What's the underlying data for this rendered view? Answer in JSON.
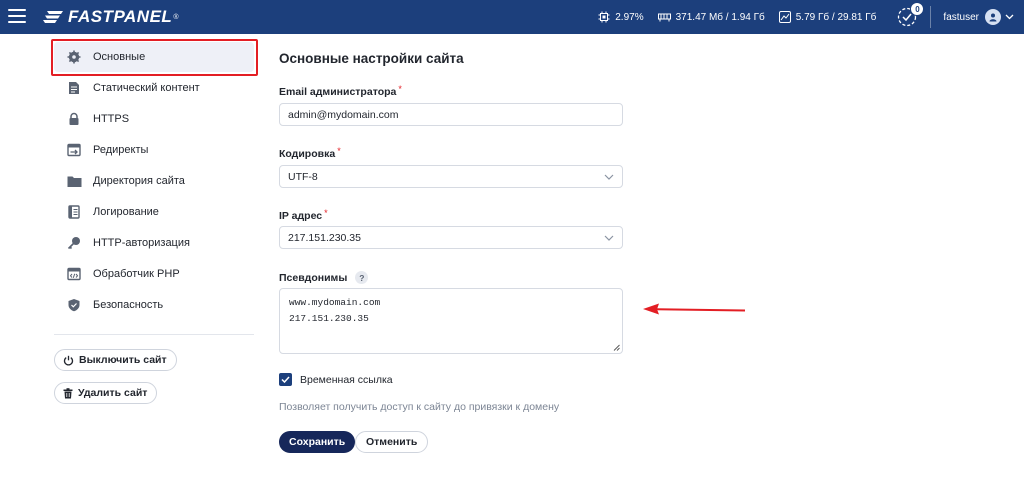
{
  "header": {
    "brand": "FASTPANEL",
    "brand_mark": "®",
    "cpu": "2.97%",
    "memory": "371.47 Мб / 1.94 Гб",
    "disk": "5.79 Гб / 29.81 Гб",
    "tasks_count": "0",
    "username": "fastuser",
    "bg_color": "#1c3f7c"
  },
  "sidebar": {
    "items": [
      {
        "label": "Основные",
        "icon": "gear-icon",
        "active": true
      },
      {
        "label": "Статический контент",
        "icon": "document-icon"
      },
      {
        "label": "HTTPS",
        "icon": "lock-icon"
      },
      {
        "label": "Редиректы",
        "icon": "redirect-icon"
      },
      {
        "label": "Директория сайта",
        "icon": "folder-icon"
      },
      {
        "label": "Логирование",
        "icon": "log-icon"
      },
      {
        "label": "HTTP-авторизация",
        "icon": "key-icon"
      },
      {
        "label": "Обработчик PHP",
        "icon": "code-icon"
      },
      {
        "label": "Безопасность",
        "icon": "shield-icon"
      }
    ],
    "disable_label": "Выключить сайт",
    "delete_label": "Удалить сайт",
    "highlight_color": "#e31e24"
  },
  "main": {
    "title": "Основные настройки сайта",
    "email_label": "Email администратора",
    "email_value": "admin@mydomain.com",
    "encoding_label": "Кодировка",
    "encoding_value": "UTF-8",
    "ip_label": "IP адрес",
    "ip_value": "217.151.230.35",
    "aliases_label": "Псевдонимы",
    "aliases_help": "?",
    "aliases": [
      "www.mydomain.com",
      "217.151.230.35"
    ],
    "temp_link_label": "Временная ссылка",
    "temp_link_checked": true,
    "temp_link_hint": "Позволяет получить доступ к сайту до привязки к домену",
    "save_label": "Сохранить",
    "cancel_label": "Отменить",
    "required_mark": "*"
  }
}
